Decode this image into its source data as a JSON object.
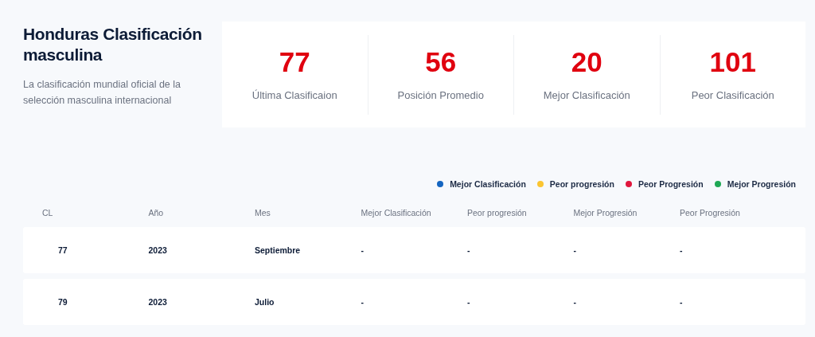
{
  "header": {
    "title": "Honduras Clasificación masculina",
    "subtitle": "La clasificación mundial oficial de la selección masculina internacional"
  },
  "stats": [
    {
      "value": "77",
      "label": "Última Clasificaion"
    },
    {
      "value": "56",
      "label": "Posición Promedio"
    },
    {
      "value": "20",
      "label": "Mejor Clasificación"
    },
    {
      "value": "101",
      "label": "Peor Clasificación"
    }
  ],
  "legend": [
    {
      "label": "Mejor Clasificación",
      "color": "#1565c0"
    },
    {
      "label": "Peor progresión",
      "color": "#fbc531"
    },
    {
      "label": "Peor Progresión",
      "color": "#e0173d"
    },
    {
      "label": "Mejor Progresión",
      "color": "#1fa855"
    }
  ],
  "table": {
    "columns": [
      "CL",
      "Año",
      "Mes",
      "Mejor Clasificación",
      "Peor progresión",
      "Mejor Progresión",
      "Peor Progresión"
    ],
    "rows": [
      [
        "77",
        "2023",
        "Septiembre",
        "-",
        "-",
        "-",
        "-"
      ],
      [
        "79",
        "2023",
        "Julio",
        "-",
        "-",
        "-",
        "-"
      ]
    ]
  }
}
